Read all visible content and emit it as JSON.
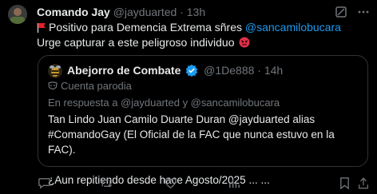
{
  "tweet": {
    "author_name": "Comando Jay",
    "handle": "@jayduarted",
    "separator": "·",
    "time": "13h",
    "line1_text": "Positivo para Demencia Extrema sñres ",
    "line1_mention": "@sancamilobucara",
    "line2_text": "Urge capturar a este peligroso individuo"
  },
  "quote": {
    "author_name": "Abejorro de Combate",
    "handle": "@1De888",
    "separator": "·",
    "time": "14h",
    "parody_label": "Cuenta parodia",
    "reply_to": "En respuesta a @jayduarted y @sancamilobucara",
    "body_para1": "Tan Lindo Juan Camilo Duarte Duran @jayduarted alias #ComandoGay (El Oficial de la FAC que nunca estuvo en la FAC).",
    "body_para2": "¿Aun repitiendo desde hace Agosto/2025 ... ..."
  },
  "colors": {
    "background": "#000000",
    "text": "#e7e9ea",
    "muted": "#71767b",
    "link": "#1d9bf0",
    "border": "#2f3336",
    "verified": "#1d9bf0"
  },
  "icons": [
    "grok-icon",
    "more-icon",
    "flag-icon",
    "angry-face-icon",
    "verified-icon",
    "mask-icon",
    "reply-icon",
    "retweet-icon",
    "like-icon",
    "views-icon",
    "bookmark-icon",
    "share-icon"
  ]
}
